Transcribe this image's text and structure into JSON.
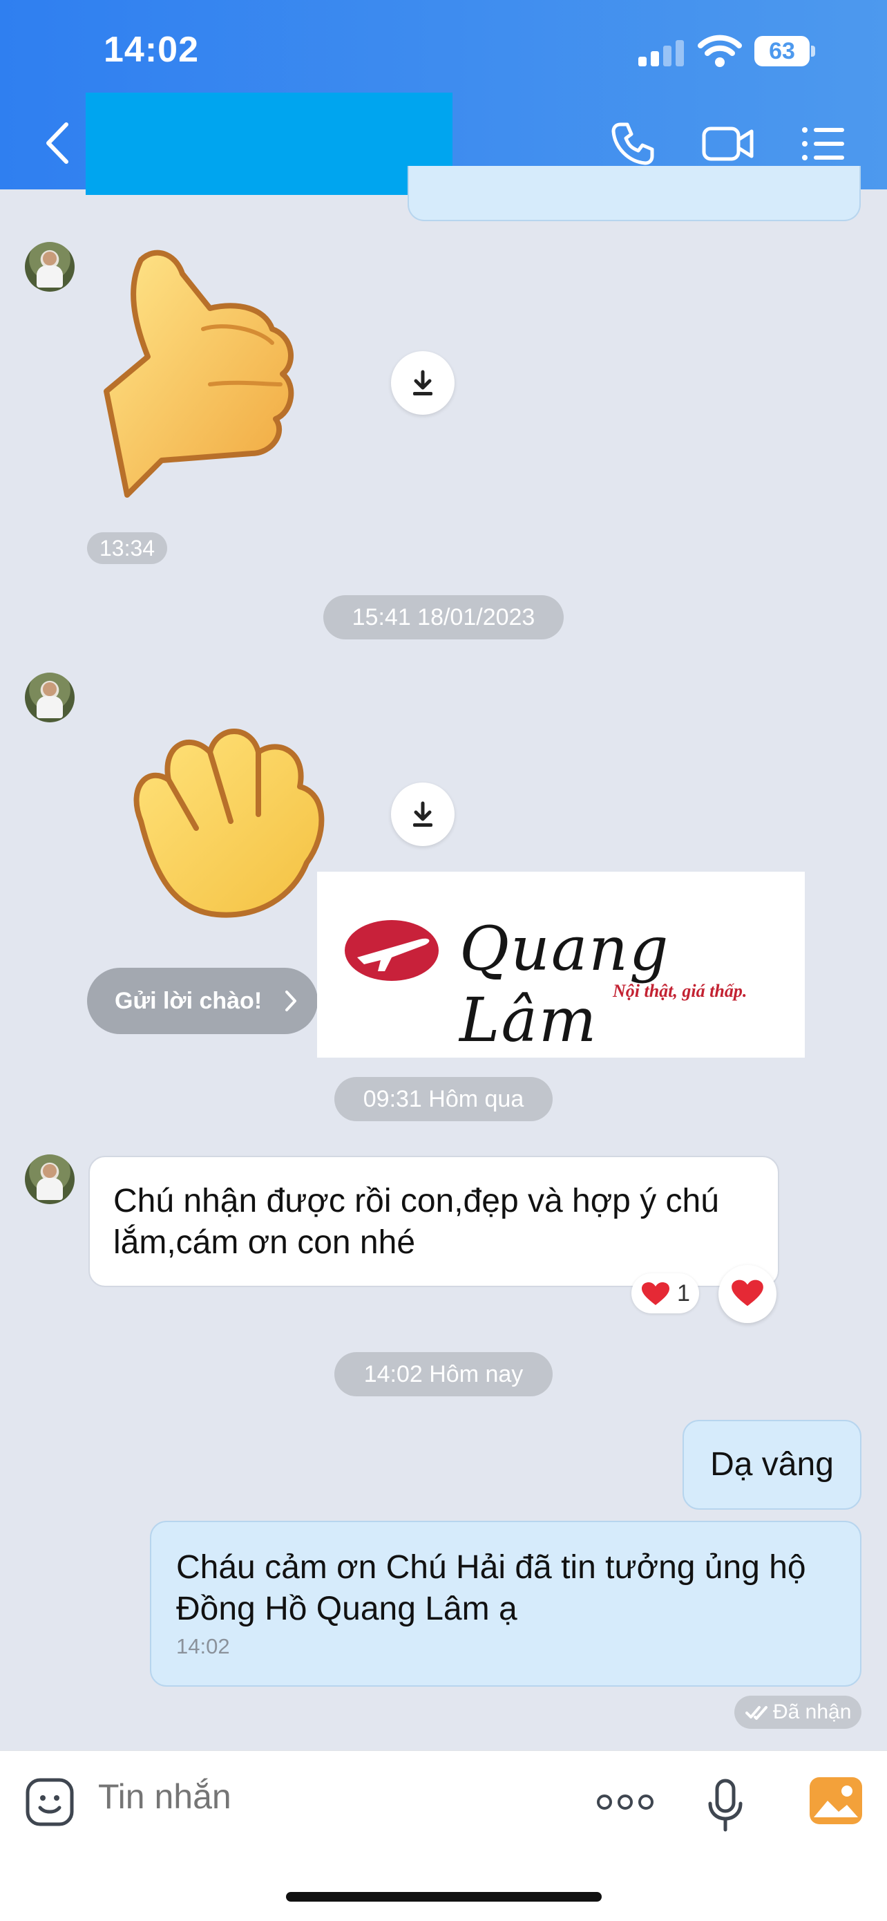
{
  "status_bar": {
    "time": "14:02",
    "battery": "63"
  },
  "header": {
    "back_icon": "chevron-left-icon",
    "call_icon": "phone-icon",
    "video_icon": "video-camera-icon",
    "menu_icon": "list-menu-icon",
    "colors": {
      "gradient_start": "#2f7ff0",
      "gradient_end": "#4d99ee",
      "redaction": "#00a5ef"
    }
  },
  "chat": {
    "messages": [
      {
        "type": "sticker",
        "sender": "contact",
        "sticker": "thumbs-up",
        "time": "13:34"
      },
      {
        "type": "date_separator",
        "text": "15:41 18/01/2023"
      },
      {
        "type": "sticker",
        "sender": "contact",
        "sticker": "waving-hand"
      },
      {
        "type": "action",
        "label": "Gửi lời chào!"
      },
      {
        "type": "image",
        "sender": "contact",
        "brand": "Quang Lâm",
        "tagline": "Nội thật, giá thấp."
      },
      {
        "type": "date_separator",
        "text": "09:31 Hôm qua"
      },
      {
        "type": "text",
        "sender": "contact",
        "text": "Chú nhận được rồi con,đẹp và hợp ý chú lắm,cám ơn con nhé",
        "reaction": "heart",
        "reaction_count": "1"
      },
      {
        "type": "date_separator",
        "text": "14:02 Hôm nay"
      },
      {
        "type": "text",
        "sender": "me",
        "text": "Dạ vâng"
      },
      {
        "type": "text",
        "sender": "me",
        "text": "Cháu cảm ơn Chú Hải đã tin tưởng ủng hộ Đồng Hồ Quang Lâm ạ",
        "time": "14:02"
      }
    ],
    "status": "Đã nhận"
  },
  "input_bar": {
    "placeholder": "Tin nhắn"
  }
}
